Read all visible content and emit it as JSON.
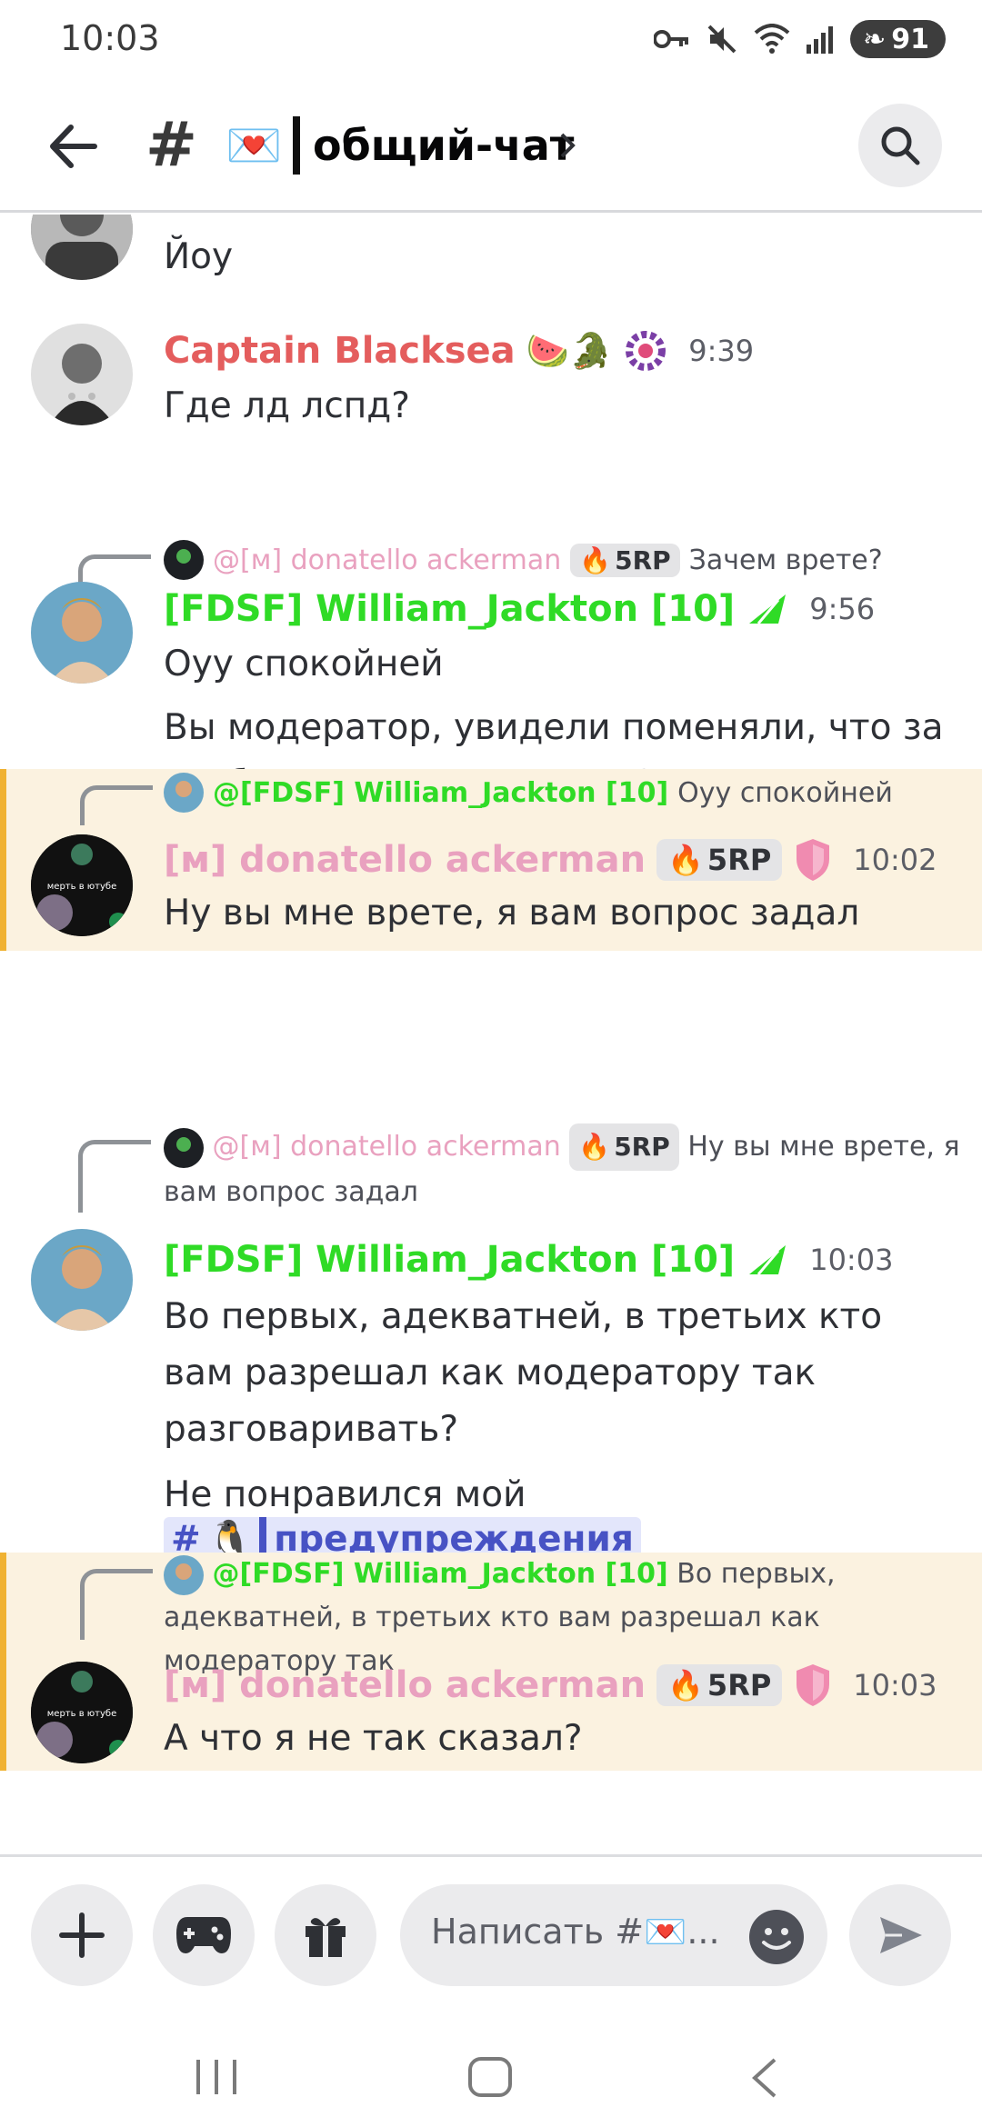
{
  "status_bar": {
    "time": "10:03",
    "battery": "91"
  },
  "header": {
    "channel_emoji": "💌",
    "channel_name": "общий-чат"
  },
  "messages": [
    {
      "type": "continuation",
      "text": "Йоу"
    },
    {
      "author": "Captain Blacksea",
      "author_emojis": "🍉🐊",
      "time": "9:39",
      "text": "Где лд лспд?"
    },
    {
      "reply": {
        "author": "@[м] donatello ackerman",
        "badge": "5RP",
        "text": "Зачем врете?"
      },
      "author": "[FDSF] William_Jackton [10]",
      "time": "9:56",
      "text": "Оуу спокойней",
      "text2": "Вы модератор, увидели поменяли, что за разборки тут устраивать?"
    },
    {
      "reply": {
        "author": "@[FDSF] William_Jackton [10]",
        "text": "Оуу спокойней"
      },
      "author": "[м] donatello ackerman",
      "badge": "5RP",
      "time": "10:02",
      "text": "Ну вы мне врете, я вам вопрос задал",
      "avatar_text": "мерть в ютубе"
    },
    {
      "reply": {
        "author": "@[м] donatello ackerman",
        "badge": "5RP",
        "text": "Ну вы мне врете, я вам вопрос задал"
      },
      "author": "[FDSF] William_Jackton [10]",
      "time": "10:03",
      "text": "Во первых, адекватней, в третьих кто вам разрешал как модератору так разговаривать?",
      "text2": "Не понравился мой никнейм вам сюда",
      "channel_mention": {
        "emoji": "🐧",
        "name": "предупреждения"
      }
    },
    {
      "reply": {
        "author": "@[FDSF] William_Jackton [10]",
        "text": "Во первых, адекватней, в третьих кто вам разрешал как модератору так"
      },
      "author": "[м] donatello ackerman",
      "badge": "5RP",
      "time": "10:03",
      "text": "А что я не так сказал?",
      "avatar_text": "мерть в ютубе"
    }
  ],
  "composer": {
    "placeholder": "Написать #💌..."
  },
  "colors": {
    "mod_pink": "#e9a1bf",
    "fdsf_green": "#2fdb26",
    "captain_red": "#e45d5d",
    "highlight_bg": "#fbf2e0",
    "highlight_border": "#f0b232",
    "mention_blue": "#4752c4"
  },
  "icons": [
    "back-arrow-icon",
    "hash-icon",
    "search-icon",
    "plus-icon",
    "gamepad-icon",
    "gift-icon",
    "emoji-icon",
    "send-icon"
  ]
}
